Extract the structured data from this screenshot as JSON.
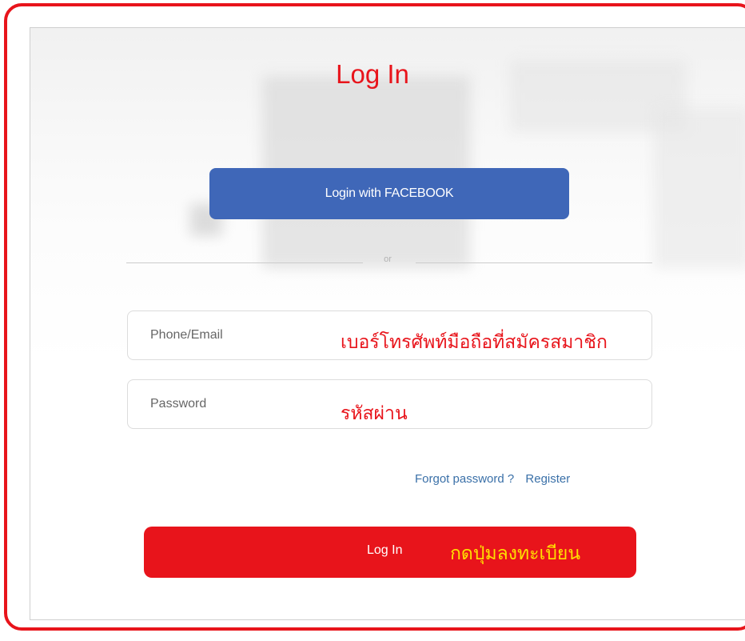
{
  "title": "Log In",
  "facebook_button": {
    "label": "Login with FACEBOOK",
    "color": "#3f67b8"
  },
  "divider": {
    "text": "or"
  },
  "phone_field": {
    "placeholder": "Phone/Email",
    "annotation": "เบอร์โทรศัพท์มือถือที่สมัครสมาชิก"
  },
  "password_field": {
    "placeholder": "Password",
    "annotation": "รหัสผ่าน"
  },
  "links": {
    "forgot": "Forgot password ?",
    "register": "Register"
  },
  "login_button": {
    "label": "Log In",
    "annotation": "กดปุ่มลงทะเบียน",
    "color": "#e8141b"
  },
  "colors": {
    "accent": "#e8141b",
    "annotation_yellow": "#ffe000",
    "link": "#3a70a8"
  }
}
